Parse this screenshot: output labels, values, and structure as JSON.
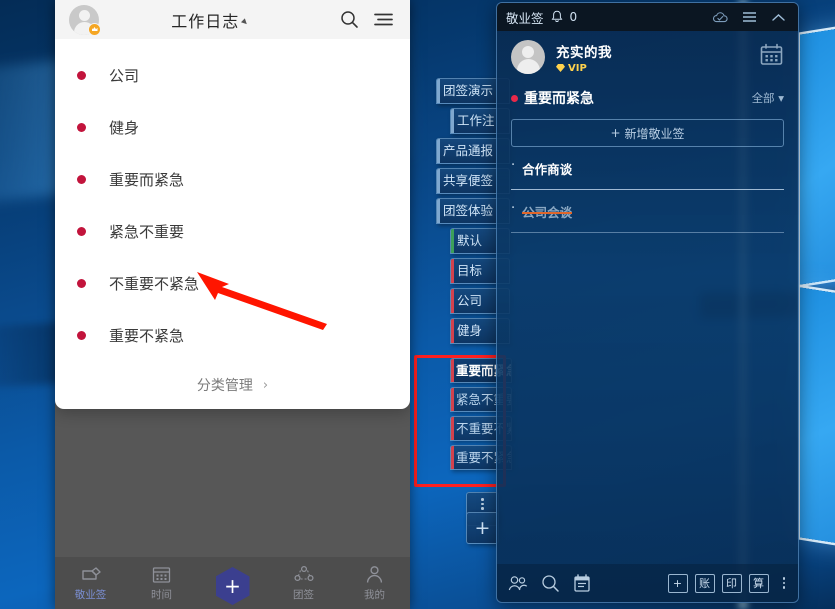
{
  "phone": {
    "title": "工作日志",
    "title_caret": "◢",
    "search_icon": "search-icon",
    "menu_icon": "menu-icon",
    "dropdown": {
      "items": [
        {
          "label": "公司"
        },
        {
          "label": "健身"
        },
        {
          "label": "重要而紧急"
        },
        {
          "label": "紧急不重要"
        },
        {
          "label": "不重要不紧急"
        },
        {
          "label": "重要不紧急"
        }
      ],
      "manage_label": "分类管理",
      "manage_chevron": "›",
      "dot_color": "#c2143c"
    },
    "nav": [
      {
        "label": "敬业签",
        "icon": "cloud-note-icon",
        "active": true
      },
      {
        "label": "时间",
        "icon": "calendar-icon",
        "active": false
      },
      {
        "label": "",
        "icon": "add-hex-icon",
        "active": false,
        "plus": "+"
      },
      {
        "label": "团签",
        "icon": "team-icon",
        "active": false
      },
      {
        "label": "我的",
        "icon": "person-icon",
        "active": false
      }
    ]
  },
  "tabstrip": {
    "items": [
      {
        "label": "团签演示",
        "bar": "#7fa8cf",
        "indent": false
      },
      {
        "label": "工作注",
        "bar": "#7fa8cf",
        "indent": true
      },
      {
        "label": "产品通报",
        "bar": "#7fa8cf",
        "indent": false
      },
      {
        "label": "共享便签",
        "bar": "#7fa8cf",
        "indent": false
      },
      {
        "label": "团签体验",
        "bar": "#7fa8cf",
        "indent": false
      },
      {
        "label": "默认",
        "bar": "#3ca05a",
        "indent": true
      },
      {
        "label": "目标",
        "bar": "#d2424e",
        "indent": true
      },
      {
        "label": "公司",
        "bar": "#d2424e",
        "indent": true
      },
      {
        "label": "健身",
        "bar": "#d2424e",
        "indent": true
      }
    ]
  },
  "tabstrip2": {
    "items": [
      {
        "label": "重要而紧急",
        "bar": "#d2424e",
        "active": true
      },
      {
        "label": "紧急不重要",
        "bar": "#d2424e",
        "active": false
      },
      {
        "label": "不重要不紧急",
        "bar": "#d2424e",
        "active": false
      },
      {
        "label": "重要不紧急",
        "bar": "#d2424e",
        "active": false
      }
    ],
    "dots_label": "⋮",
    "plus_label": "+",
    "highlight_color": "#ff1f1f"
  },
  "desktop_app": {
    "titlebar": {
      "app_name": "敬业签",
      "bell_icon": "bell-icon",
      "notification_count": "0",
      "cloud_icon": "cloud-sync-icon",
      "menu_icon": "hamburger-menu-icon",
      "collapse_icon": "chevron-up-icon"
    },
    "user": {
      "name": "充实的我",
      "vip_label": "VIP",
      "vip_color": "#ffd24d",
      "calendar_icon": "calendar-icon"
    },
    "category": {
      "name": "重要而紧急",
      "dot_color": "#e8294a",
      "filter_label": "全部",
      "filter_caret": "▾"
    },
    "add_button": {
      "plus": "+",
      "label": "新增敬业签"
    },
    "notes": [
      {
        "text": "合作商谈",
        "done": false
      },
      {
        "text": "公司会谈",
        "done": true
      }
    ],
    "bottom_toolbar": {
      "left": [
        {
          "icon": "contacts-icon",
          "name": "contacts"
        },
        {
          "icon": "search-icon",
          "name": "search"
        },
        {
          "icon": "notepad-icon",
          "name": "notepad"
        }
      ],
      "right": [
        {
          "label": "+",
          "name": "add"
        },
        {
          "label": "账",
          "name": "ledger"
        },
        {
          "label": "印",
          "name": "stamp"
        },
        {
          "label": "算",
          "name": "calculator"
        }
      ],
      "more_icon": "more-vertical-icon"
    }
  },
  "annotation": {
    "arrow_color": "#ff1500",
    "arrow_name": "red-pointer-arrow"
  }
}
